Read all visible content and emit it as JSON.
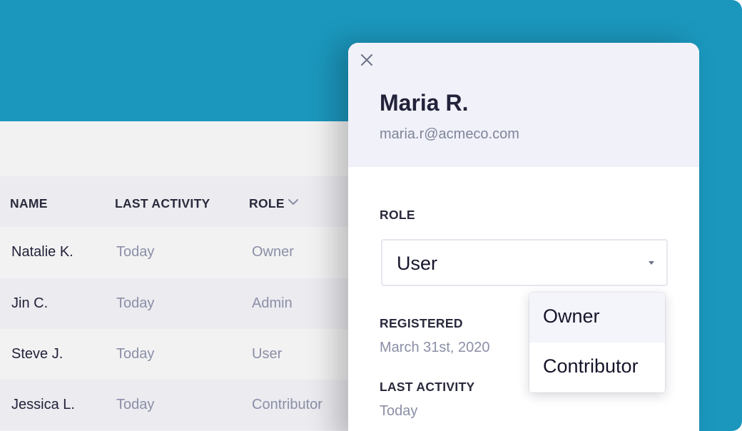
{
  "colors": {
    "backdrop": "#1b97bd",
    "header_bg": "#f0f1f9",
    "text_dark": "#22223a",
    "text_muted": "#8b8fa6"
  },
  "table": {
    "columns": {
      "name": "NAME",
      "last_activity": "LAST ACTIVITY",
      "role": "ROLE"
    },
    "sort_icon": "chevron-down-icon",
    "rows": [
      {
        "name": "Natalie K.",
        "last_activity": "Today",
        "role": "Owner"
      },
      {
        "name": "Jin C.",
        "last_activity": "Today",
        "role": "Admin"
      },
      {
        "name": "Steve J.",
        "last_activity": "Today",
        "role": "User"
      },
      {
        "name": "Jessica L.",
        "last_activity": "Today",
        "role": "Contributor"
      }
    ]
  },
  "modal": {
    "close_icon": "close-icon",
    "user": {
      "name": "Maria R.",
      "email": "maria.r@acmeco.com"
    },
    "role": {
      "label": "ROLE",
      "selected": "User",
      "caret_icon": "caret-down-icon",
      "options": [
        "Owner",
        "Contributor"
      ]
    },
    "registered": {
      "label": "REGISTERED",
      "value": "March 31st, 2020"
    },
    "last_activity": {
      "label": "LAST ACTIVITY",
      "value": "Today"
    }
  }
}
